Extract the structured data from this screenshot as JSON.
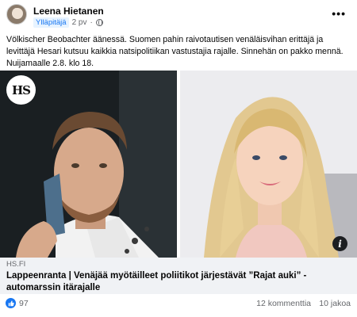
{
  "post": {
    "author": "Leena Hietanen",
    "role_badge": "Ylläpitäjä",
    "time": "2 pv",
    "separator": "·",
    "more_label": "•••",
    "text": "Völkischer Beobachter äänessä. Suomen pahin raivotautisen venäläisvihan  erittäjä ja levittäjä Hesari kutsuu kaikkia natsipolitiikan vastustajia rajalle. Sinnehän on pakko mennä. Nuijamaalle 2.8. klo 18."
  },
  "link": {
    "logo_text": "HS",
    "info_label": "i",
    "domain": "HS.FI",
    "title": "Lappeenranta | Venäjää myötäilleet poliitikot järjestävät ”Rajat auki” -automarssin itärajalle"
  },
  "stats": {
    "reactions": "97",
    "comments": "12 kommenttia",
    "shares": "10 jakoa"
  },
  "colors": {
    "accent": "#1877f2",
    "badge_bg": "#e7f3ff",
    "link_box_bg": "#f0f2f5",
    "muted_text": "#65676b"
  }
}
